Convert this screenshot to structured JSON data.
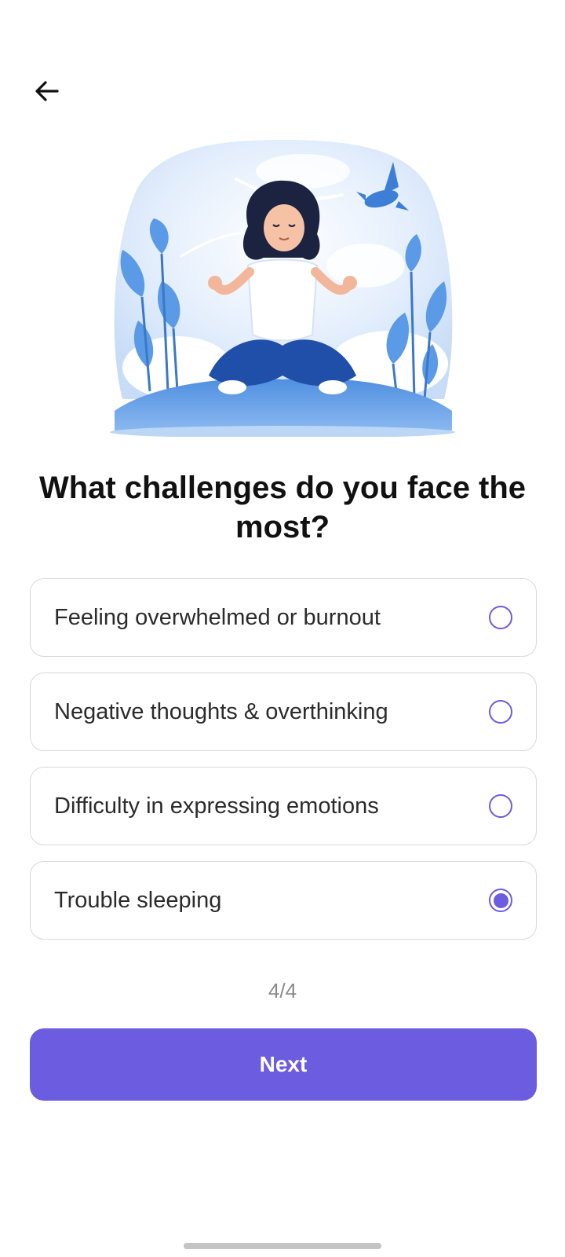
{
  "header": {
    "back_icon": "arrow-left-icon"
  },
  "illustration": {
    "name": "meditating-woman-illustration"
  },
  "question": "What challenges do you face the most?",
  "options": [
    {
      "label": "Feeling overwhelmed or burnout",
      "selected": false
    },
    {
      "label": "Negative thoughts & overthinking",
      "selected": false
    },
    {
      "label": "Difficulty in expressing emotions",
      "selected": false
    },
    {
      "label": "Trouble sleeping",
      "selected": true
    }
  ],
  "progress_text": "4/4",
  "next_label": "Next",
  "colors": {
    "accent": "#6c5ce0",
    "border": "#d8d8dc"
  }
}
